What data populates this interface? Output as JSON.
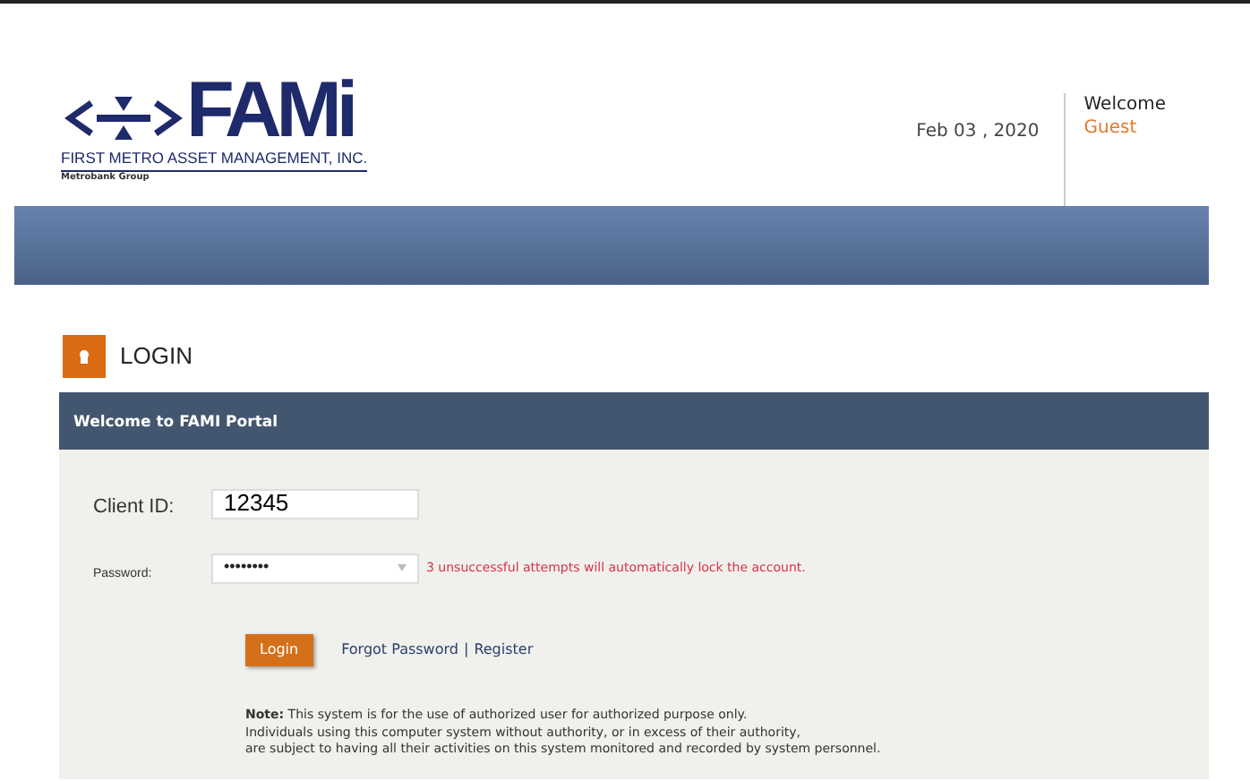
{
  "header": {
    "logo_text": "FAMi",
    "company": "FIRST METRO ASSET MANAGEMENT, INC.",
    "group": "Metrobank Group",
    "date": "Feb 03 , 2020",
    "welcome": "Welcome",
    "user": "Guest"
  },
  "page_title": "LOGIN",
  "panel": {
    "title": "Welcome to FAMI Portal",
    "fields": [
      {
        "label": "Client ID:",
        "value": "12345",
        "kind": "text"
      },
      {
        "label": "Password:",
        "value": "••••••••",
        "kind": "password",
        "warning": "3 unsuccessful attempts will automatically lock the account."
      }
    ],
    "login_button": "Login",
    "forgot_link": "Forgot Password",
    "separator": "|",
    "register_link": "Register",
    "note_lines": [
      "**Note:** This system is for the use of authorized user for authorized purpose only.",
      "Individuals using this computer system without authority, or in excess of their authority,",
      "are subject to having all their activities on this system monitored and recorded by system personnel."
    ]
  }
}
